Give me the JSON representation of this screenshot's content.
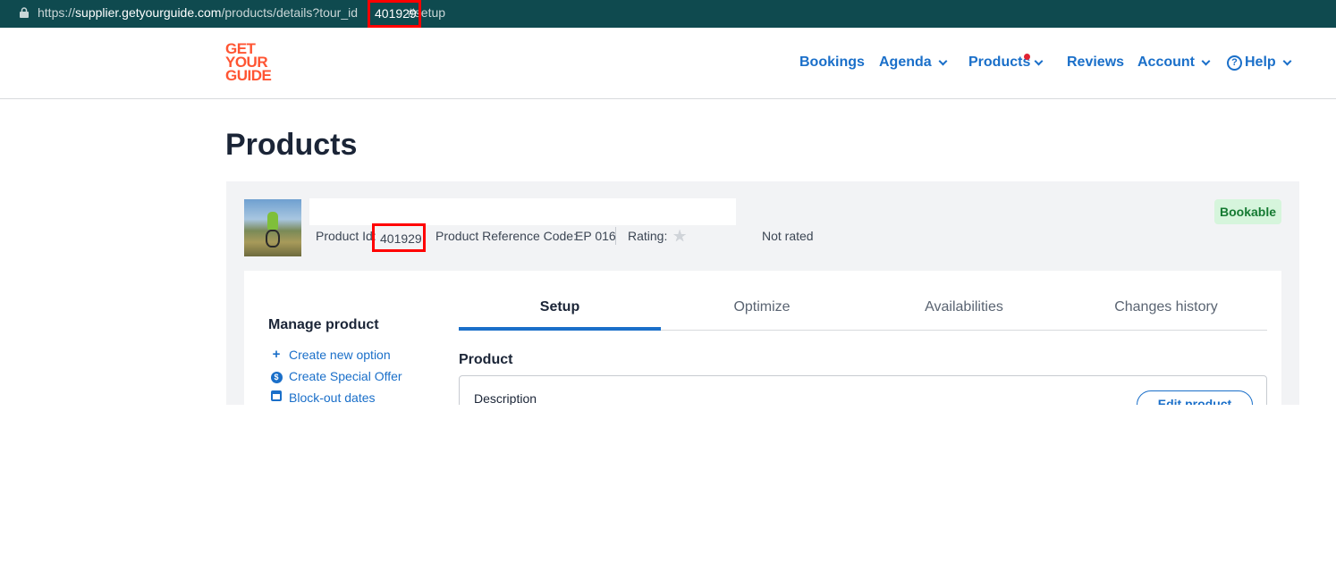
{
  "browser": {
    "url_prefix": "https://",
    "url_host": "supplier.getyourguide.com",
    "url_path": "/products/details?tour_id",
    "url_id_highlight": "401929",
    "url_suffix": "#setup"
  },
  "header": {
    "logo_line1": "GET",
    "logo_line2": "YOUR",
    "logo_line3": "GUIDE",
    "nav": {
      "bookings": "Bookings",
      "agenda": "Agenda",
      "products": "Products",
      "reviews": "Reviews",
      "account": "Account",
      "help": "Help"
    }
  },
  "page": {
    "title": "Products"
  },
  "product": {
    "id_label": "Product Id:",
    "id_value": "401929",
    "ref_label": "Product Reference Code:",
    "ref_value": "EP 016",
    "rating_label": "Rating:",
    "rating_value": "Not rated",
    "status_badge": "Bookable",
    "status_color": "#157a32"
  },
  "manage": {
    "title": "Manage product",
    "links": [
      {
        "label": "Create new option",
        "icon": "plus-icon"
      },
      {
        "label": "Create Special Offer",
        "icon": "special-offer-icon"
      },
      {
        "label": "Block-out dates",
        "icon": "calendar-icon"
      }
    ]
  },
  "tabs": [
    "Setup",
    "Optimize",
    "Availabilities",
    "Changes history"
  ],
  "active_tab": "Setup",
  "content": {
    "section_title": "Product",
    "description_label": "Description",
    "edit_button": "Edit product"
  },
  "colors": {
    "accent": "#1a6fc9",
    "brand": "#ff5533",
    "urlbar": "#0f4a4f",
    "badge_bg": "#d6f5dc"
  }
}
